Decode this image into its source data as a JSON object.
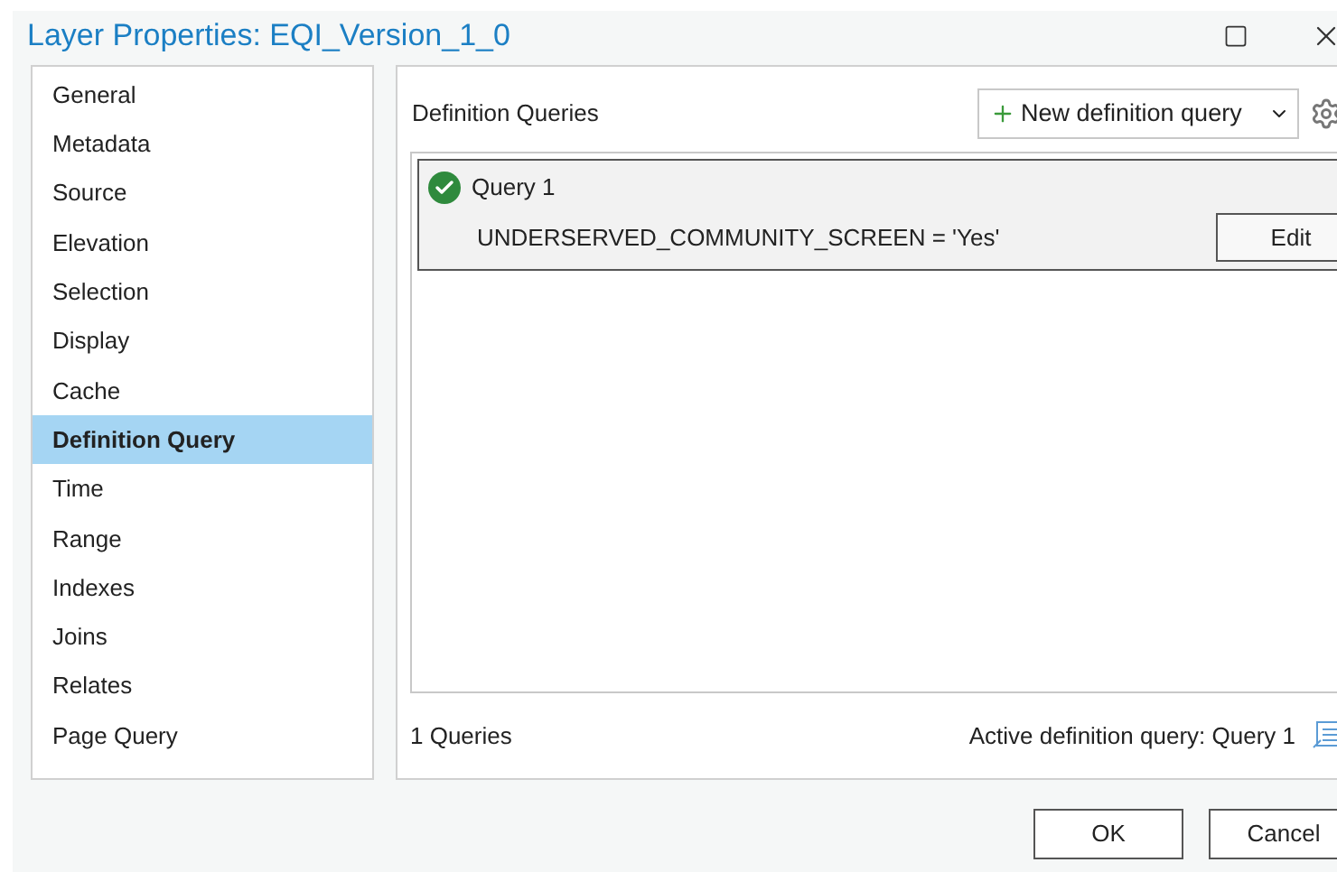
{
  "window": {
    "title": "Layer Properties: EQI_Version_1_0"
  },
  "sidebar": {
    "items": [
      {
        "label": "General",
        "selected": false
      },
      {
        "label": "Metadata",
        "selected": false
      },
      {
        "label": "Source",
        "selected": false
      },
      {
        "label": "Elevation",
        "selected": false
      },
      {
        "label": "Selection",
        "selected": false
      },
      {
        "label": "Display",
        "selected": false
      },
      {
        "label": "Cache",
        "selected": false
      },
      {
        "label": "Definition Query",
        "selected": true
      },
      {
        "label": "Time",
        "selected": false
      },
      {
        "label": "Range",
        "selected": false
      },
      {
        "label": "Indexes",
        "selected": false
      },
      {
        "label": "Joins",
        "selected": false
      },
      {
        "label": "Relates",
        "selected": false
      },
      {
        "label": "Page Query",
        "selected": false
      }
    ]
  },
  "panel": {
    "title": "Definition Queries",
    "new_button": "New definition query",
    "queries": [
      {
        "name": "Query 1",
        "active": true,
        "expression": "UNDERSERVED_COMMUNITY_SCREEN = 'Yes'",
        "edit_button": "Edit"
      }
    ],
    "count": "1 Queries",
    "active_query": "Active definition query: Query 1"
  },
  "buttons": [
    "OK",
    "Cancel"
  ]
}
